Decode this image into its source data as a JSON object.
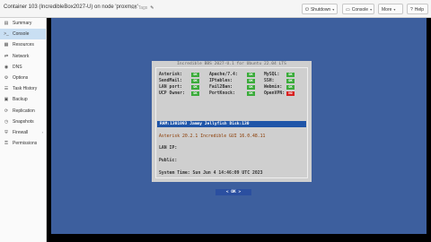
{
  "header": {
    "title": "Container 103 (IncredibleBox2027-U) on node 'proxmox'",
    "notes": "No Tags",
    "pen_icon": "pencil-icon",
    "buttons": [
      {
        "label": "Shutdown",
        "icon": "power-icon"
      },
      {
        "label": "Console",
        "icon": "terminal-icon"
      },
      {
        "label": "More",
        "icon": ""
      },
      {
        "label": "Help",
        "icon": "help-icon"
      }
    ]
  },
  "sidebar": {
    "items": [
      {
        "label": "Summary",
        "icon": "summary-icon",
        "selected": false
      },
      {
        "label": "Console",
        "icon": "terminal-icon",
        "selected": true
      },
      {
        "label": "Resources",
        "icon": "resources-icon",
        "selected": false
      },
      {
        "label": "Network",
        "icon": "network-icon",
        "selected": false
      },
      {
        "label": "DNS",
        "icon": "dns-icon",
        "selected": false
      },
      {
        "label": "Options",
        "icon": "gear-icon",
        "selected": false
      },
      {
        "label": "Task History",
        "icon": "list-icon",
        "selected": false
      },
      {
        "label": "Backup",
        "icon": "floppy-icon",
        "selected": false
      },
      {
        "label": "Replication",
        "icon": "replication-icon",
        "selected": false
      },
      {
        "label": "Snapshots",
        "icon": "history-icon",
        "selected": false
      },
      {
        "label": "Firewall",
        "icon": "shield-icon",
        "selected": false
      },
      {
        "label": "Permissions",
        "icon": "unlock-icon",
        "selected": false
      }
    ]
  },
  "console": {
    "header": "Incredible BBS 2027-U.1 for Ubuntu 22.04 LTS",
    "status_rows": [
      [
        {
          "label": "Asterisk:",
          "status": "ok"
        },
        {
          "label": "Apache/7.4:",
          "status": "ok"
        },
        {
          "label": "MySQL:",
          "status": "ok"
        }
      ],
      [
        {
          "label": "SendMail:",
          "status": "ok"
        },
        {
          "label": "IPtables:",
          "status": "ok"
        },
        {
          "label": "SSH:",
          "status": "ok"
        }
      ],
      [
        {
          "label": "LAN port:",
          "status": "ok"
        },
        {
          "label": "Fail2Ban:",
          "status": "ok"
        },
        {
          "label": "Webmin:",
          "status": "ok"
        }
      ],
      [
        {
          "label": "UCP Owner:",
          "status": "ok"
        },
        {
          "label": "PortKnock:",
          "status": "ok"
        },
        {
          "label": "OpenVPN:",
          "status": "bad"
        }
      ]
    ],
    "highlight": "RAM:1301093  Jammy Jellyfish  Disk:130",
    "versions": "Asterisk 20.2.1     Incredible GUI 16.0.48.11",
    "lan_ip": "LAN IP:",
    "public": "Public:",
    "system_time": "System Time: Sun Jun  4 14:46:09 UTC 2023",
    "ok_button": "< OK >",
    "colors": {
      "background": "#3d5f9e",
      "ok": "#3bab3b",
      "bad": "#d82020",
      "highlight": "#1f55a8"
    }
  }
}
